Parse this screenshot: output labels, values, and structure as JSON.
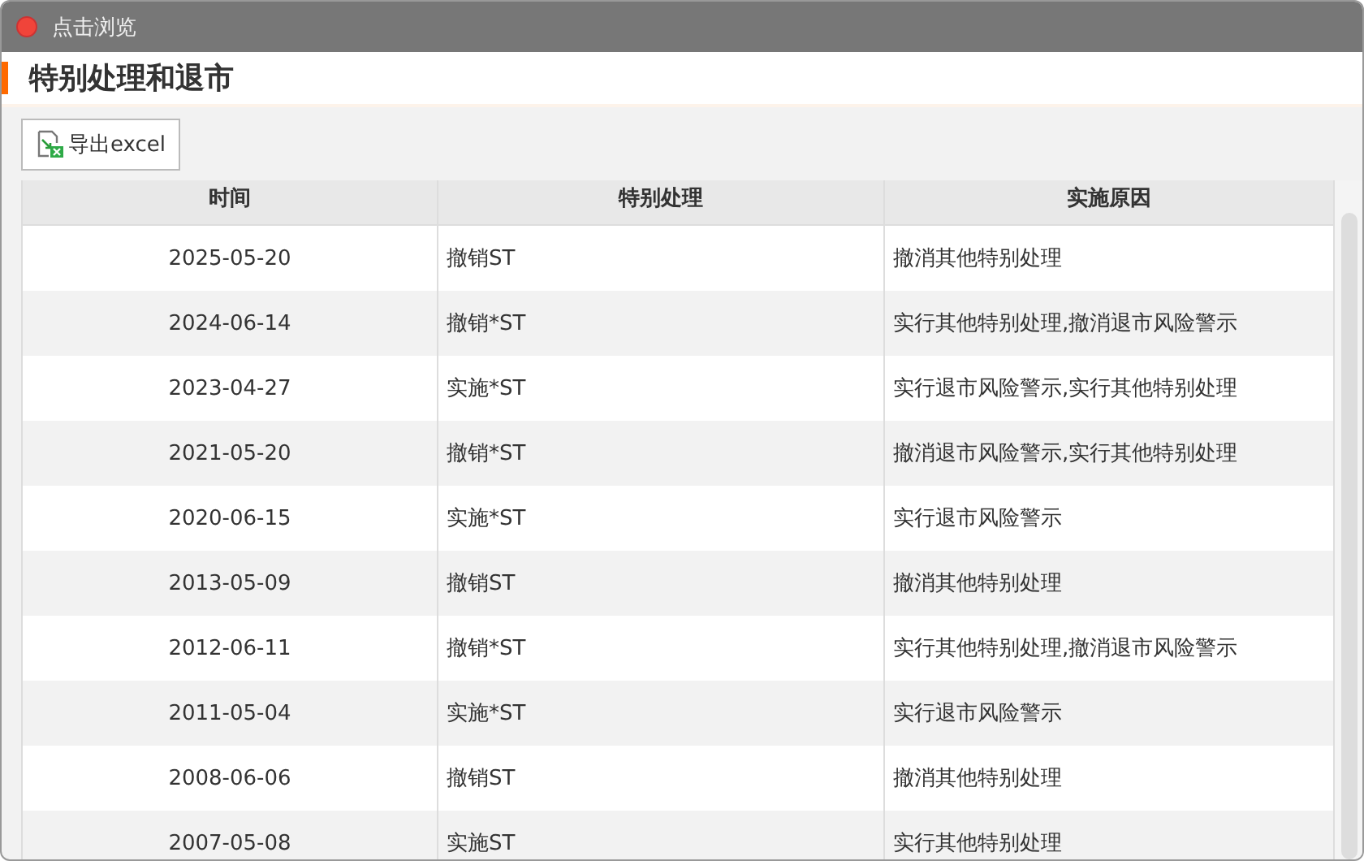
{
  "window": {
    "title": "点击浏览"
  },
  "heading": "特别处理和退市",
  "toolbar": {
    "export_button": "导出excel"
  },
  "table": {
    "columns": [
      "时间",
      "特别处理",
      "实施原因"
    ],
    "rows": [
      [
        "2025-05-20",
        "撤销ST",
        "撤消其他特别处理"
      ],
      [
        "2024-06-14",
        "撤销*ST",
        "实行其他特别处理,撤消退市风险警示"
      ],
      [
        "2023-04-27",
        "实施*ST",
        "实行退市风险警示,实行其他特别处理"
      ],
      [
        "2021-05-20",
        "撤销*ST",
        "撤消退市风险警示,实行其他特别处理"
      ],
      [
        "2020-06-15",
        "实施*ST",
        "实行退市风险警示"
      ],
      [
        "2013-05-09",
        "撤销ST",
        "撤消其他特别处理"
      ],
      [
        "2012-06-11",
        "撤销*ST",
        "实行其他特别处理,撤消退市风险警示"
      ],
      [
        "2011-05-04",
        "实施*ST",
        "实行退市风险警示"
      ],
      [
        "2008-06-06",
        "撤销ST",
        "撤消其他特别处理"
      ],
      [
        "2007-05-08",
        "实施ST",
        "实行其他特别处理"
      ]
    ]
  }
}
